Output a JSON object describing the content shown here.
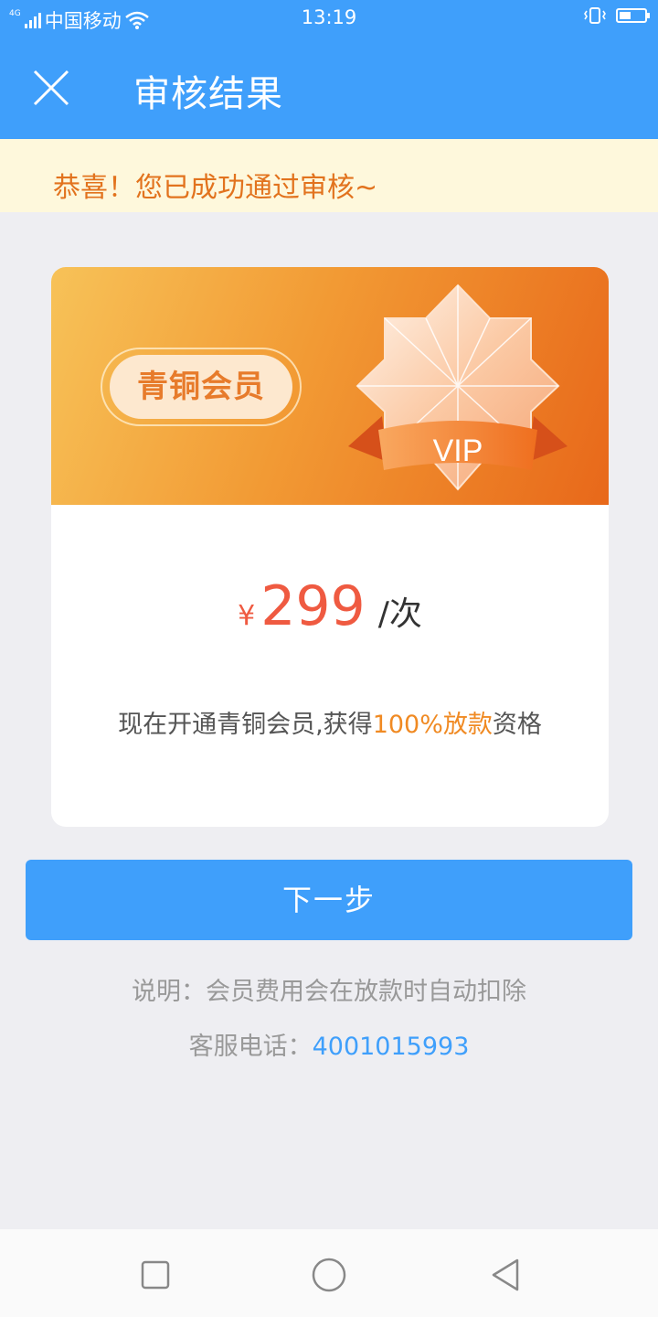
{
  "status_bar": {
    "network_type": "4G",
    "carrier": "中国移动",
    "time": "13:19",
    "icons": [
      "signal-icon",
      "wifi-icon",
      "vibrate-icon",
      "battery-icon"
    ]
  },
  "header": {
    "title": "审核结果",
    "close_icon": "close-icon"
  },
  "notice": {
    "text": "恭喜！您已成功通过审核~"
  },
  "card": {
    "tier_label": "青铜会员",
    "badge_text": "VIP",
    "currency": "¥",
    "price": "299",
    "unit": "/次",
    "benefit_prefix": "现在开通青铜会员,获得",
    "benefit_highlight": "100%放款",
    "benefit_suffix": "资格"
  },
  "actions": {
    "next_label": "下一步"
  },
  "footer": {
    "note": "说明：会员费用会在放款时自动扣除",
    "hotline_label": "客服电话：",
    "hotline_number": "4001015993"
  },
  "colors": {
    "primary": "#3f9ffb",
    "price": "#ef5a41",
    "highlight": "#f08a23",
    "notice_bg": "#fef8dc",
    "notice_text": "#e2731e"
  }
}
